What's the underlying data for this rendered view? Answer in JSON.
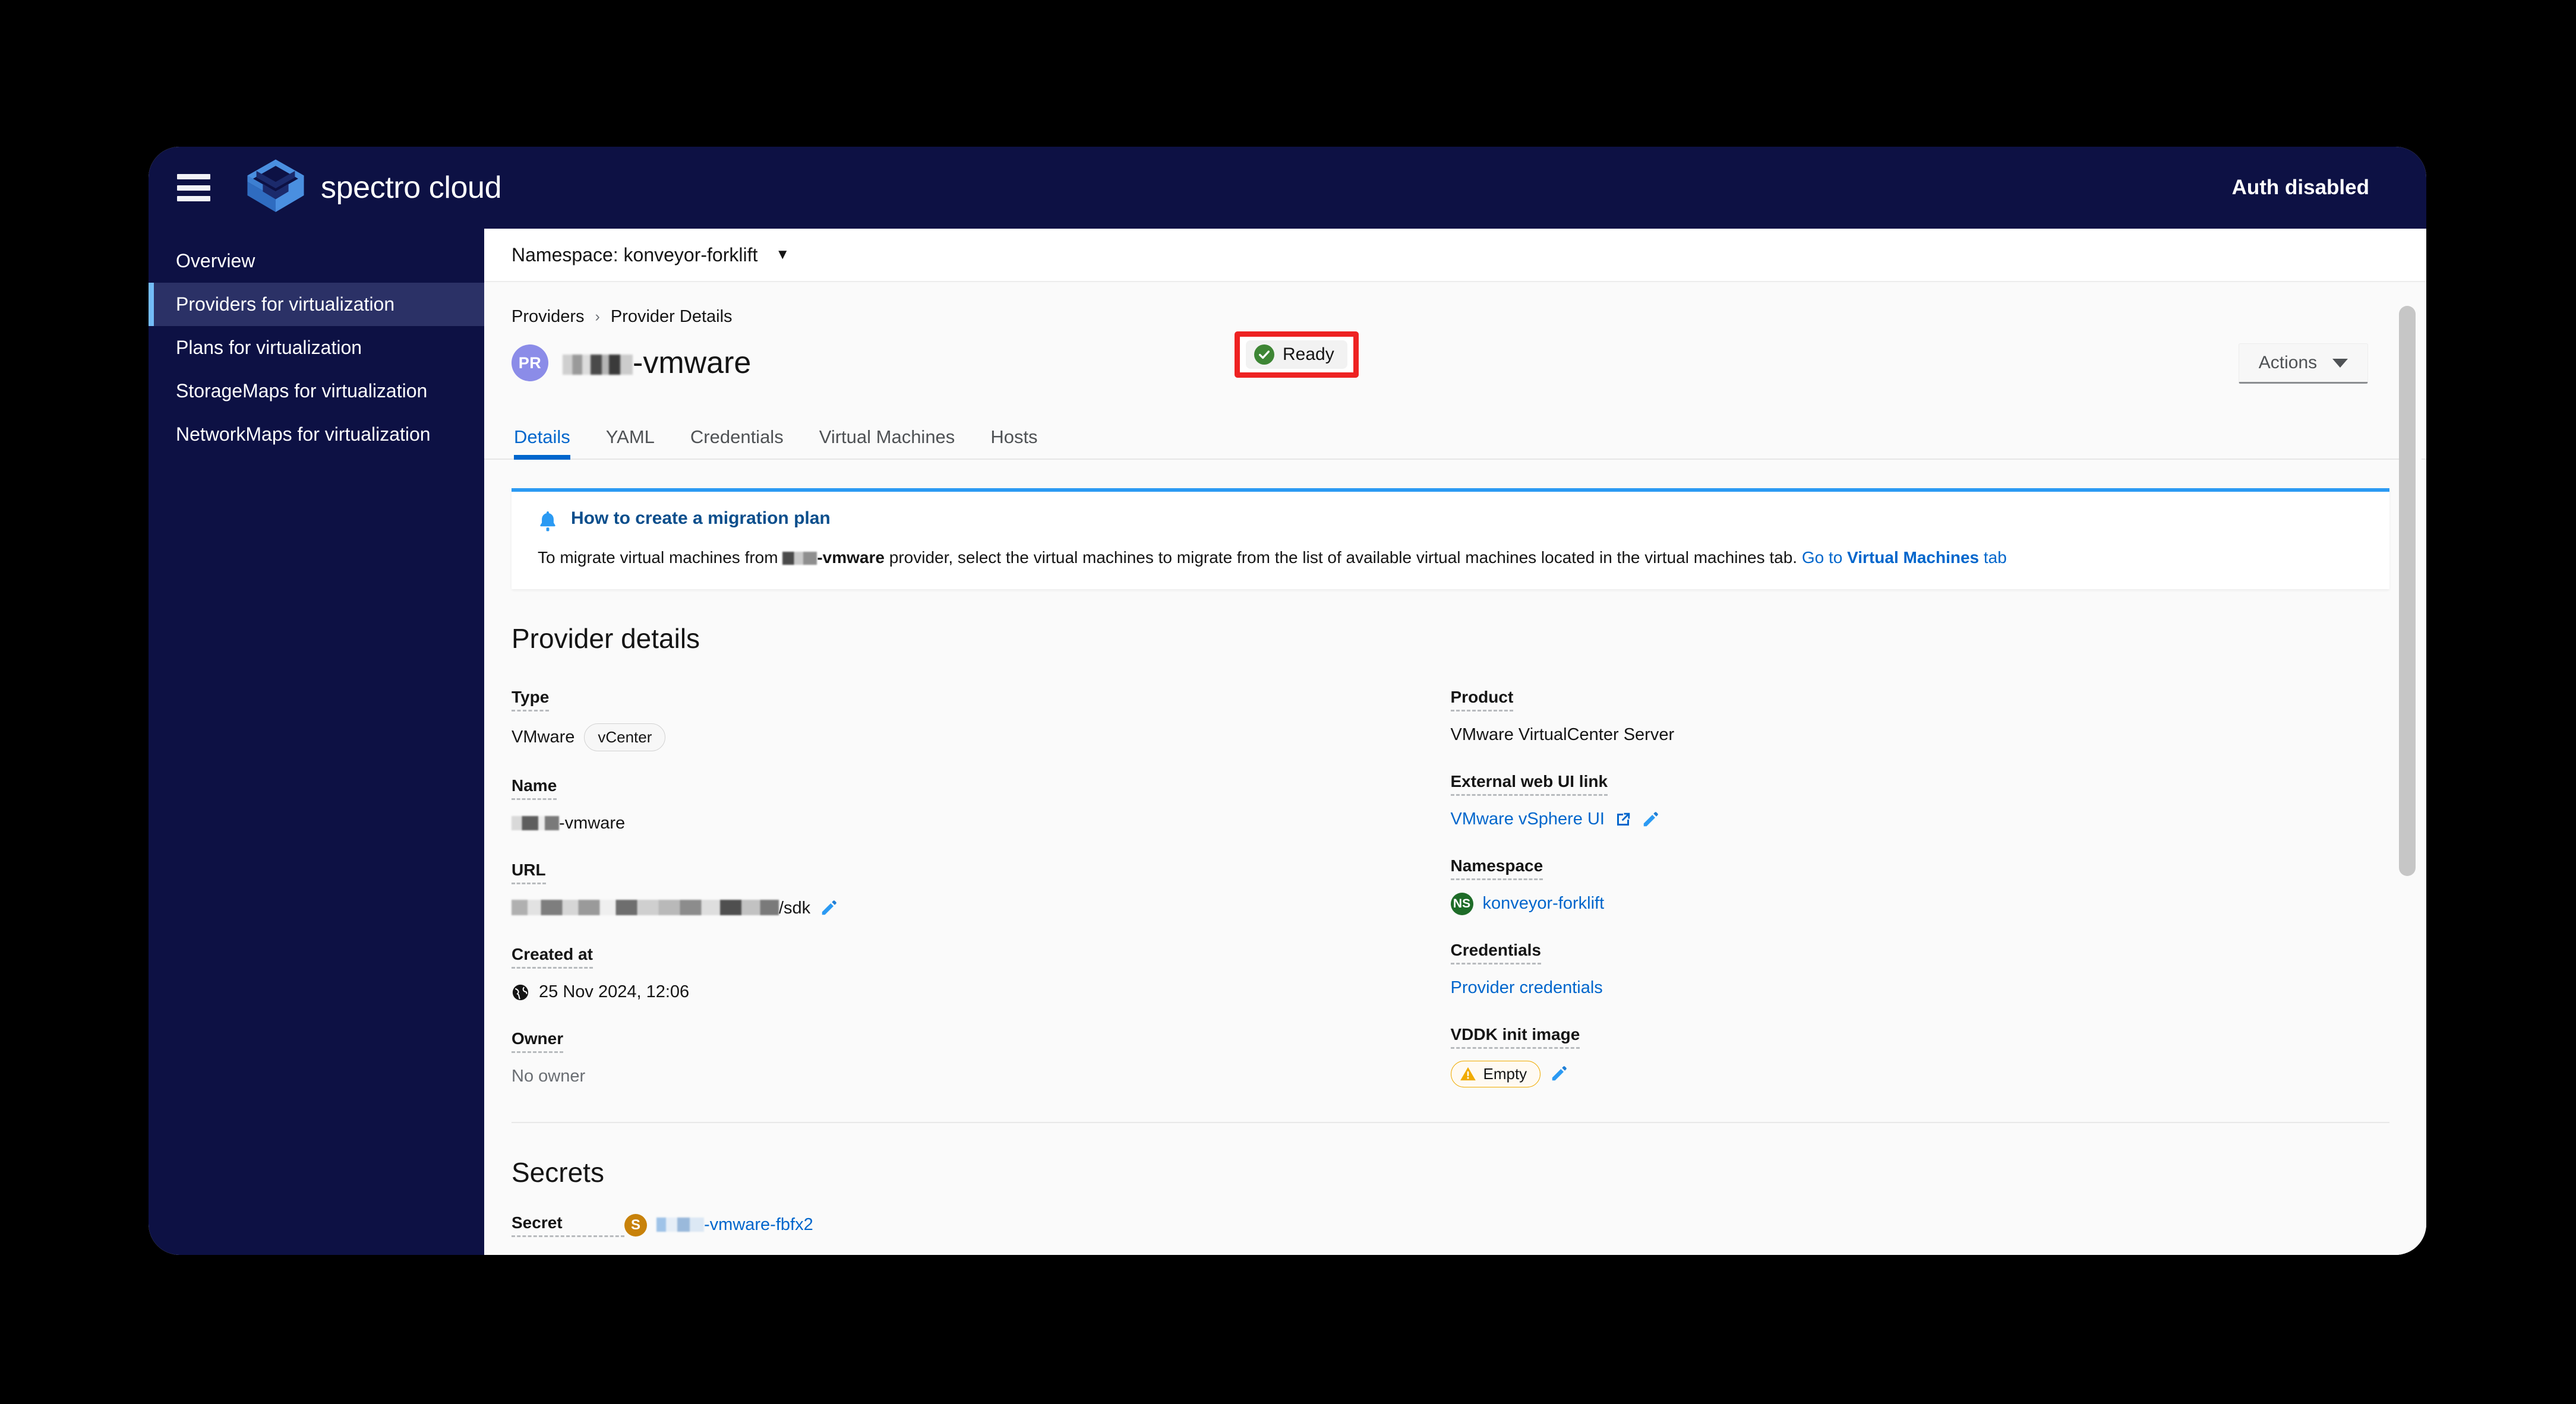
{
  "masthead": {
    "hamburger_icon": "hamburger-menu-icon",
    "logo_icon": "spectro-cloud-logo-icon",
    "brand": "spectro cloud",
    "auth_status": "Auth disabled"
  },
  "sidebar": {
    "items": [
      {
        "label": "Overview",
        "active": false
      },
      {
        "label": "Providers for virtualization",
        "active": true
      },
      {
        "label": "Plans for virtualization",
        "active": false
      },
      {
        "label": "StorageMaps for virtualization",
        "active": false
      },
      {
        "label": "NetworkMaps for virtualization",
        "active": false
      }
    ]
  },
  "namespace_bar": {
    "label": "Namespace: konveyor-forklift",
    "caret_icon": "chevron-down-icon"
  },
  "breadcrumb": {
    "parent": "Providers",
    "separator": "›",
    "current": "Provider Details"
  },
  "page_header": {
    "badge": "PR",
    "title_suffix": "-vmware",
    "status": "Ready",
    "status_icon": "check-circle-icon",
    "actions_label": "Actions",
    "actions_caret_icon": "caret-down-icon"
  },
  "tabs": [
    {
      "label": "Details",
      "active": true
    },
    {
      "label": "YAML",
      "active": false
    },
    {
      "label": "Credentials",
      "active": false
    },
    {
      "label": "Virtual Machines",
      "active": false
    },
    {
      "label": "Hosts",
      "active": false
    }
  ],
  "alert": {
    "icon": "bell-icon",
    "title": "How to create a migration plan",
    "body_before": "To migrate virtual machines from ",
    "provider_suffix": "-vmware",
    "body_after": " provider, select the virtual machines to migrate from the list of available virtual machines located in the virtual machines tab. ",
    "link_prefix": "Go to ",
    "link_bold": "Virtual Machines",
    "link_suffix": " tab"
  },
  "provider_details": {
    "heading": "Provider details",
    "left": [
      {
        "term": "Type",
        "value": "VMware",
        "chip": "vCenter",
        "kind": "type"
      },
      {
        "term": "Name",
        "value_suffix": "-vmware",
        "kind": "name"
      },
      {
        "term": "URL",
        "value_suffix": "/sdk",
        "edit_icon": "pencil-icon",
        "kind": "url"
      },
      {
        "term": "Created at",
        "value": "25 Nov 2024, 12:06",
        "icon": "globe-icon",
        "kind": "created"
      },
      {
        "term": "Owner",
        "value": "No owner",
        "kind": "owner"
      }
    ],
    "right": [
      {
        "term": "Product",
        "value": "VMware VirtualCenter Server",
        "kind": "product"
      },
      {
        "term": "External web UI link",
        "value": "VMware vSphere UI",
        "external_icon": "external-link-icon",
        "edit_icon": "pencil-icon",
        "kind": "weblink"
      },
      {
        "term": "Namespace",
        "value": "konveyor-forklift",
        "badge": "NS",
        "kind": "namespace"
      },
      {
        "term": "Credentials",
        "value": "Provider credentials",
        "kind": "credentials"
      },
      {
        "term": "VDDK init image",
        "value": "Empty",
        "warn_icon": "warning-triangle-icon",
        "edit_icon": "pencil-icon",
        "kind": "vddk"
      }
    ]
  },
  "secrets": {
    "heading": "Secrets",
    "term": "Secret",
    "badge": "S",
    "value_suffix": "-vmware-fbfx2"
  },
  "colors": {
    "brand_navy": "#0d1144",
    "sidebar_active": "#2b3166",
    "accent_blue": "#0066cc",
    "link_blue": "#2b9af3",
    "ready_green": "#3e8635",
    "highlight_red": "#ee2222",
    "warn_orange": "#f0ab00",
    "badge_purple": "#8b8ce8",
    "ns_green": "#1e6c28",
    "secret_orange": "#c8820a"
  }
}
